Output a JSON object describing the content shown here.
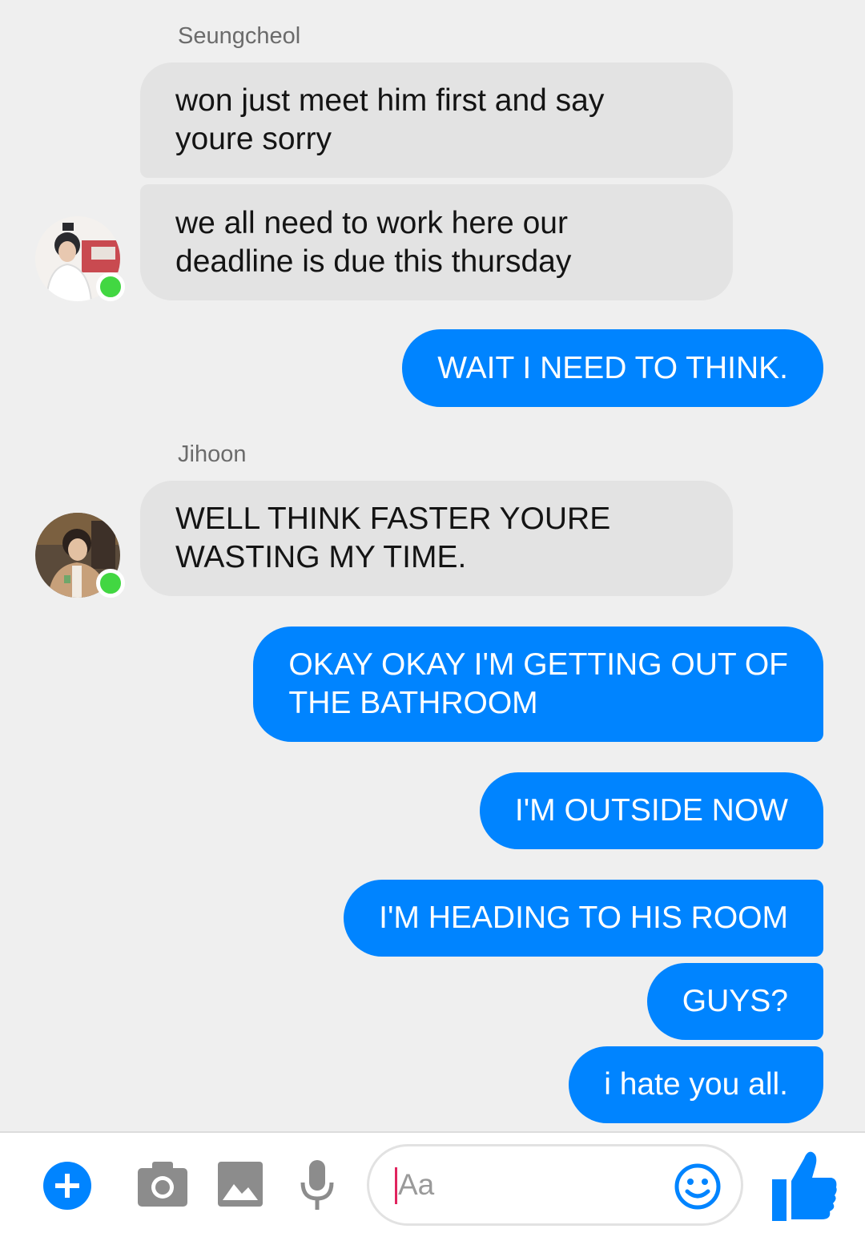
{
  "messages": [
    {
      "type": "sender",
      "name": "Seungcheol"
    },
    {
      "type": "in",
      "text": "won just meet him first and say\nyoure sorry"
    },
    {
      "type": "in",
      "text": "we all need to work here our\ndeadline is due this thursday"
    },
    {
      "type": "out",
      "text": "WAIT I NEED TO THINK."
    },
    {
      "type": "sender",
      "name": "Jihoon"
    },
    {
      "type": "in",
      "text": "WELL THINK FASTER YOURE\nWASTING MY TIME."
    },
    {
      "type": "out",
      "text": "OKAY OKAY I'M GETTING OUT OF\nTHE BATHROOM"
    },
    {
      "type": "out",
      "text": "I'M OUTSIDE NOW"
    },
    {
      "type": "out",
      "text": "I'M HEADING TO HIS ROOM"
    },
    {
      "type": "out",
      "text": "GUYS?"
    },
    {
      "type": "out",
      "text": "i hate you all."
    }
  ],
  "composer": {
    "placeholder": "Aa",
    "icons": [
      "plus-icon",
      "camera-icon",
      "image-icon",
      "microphone-icon",
      "emoji-icon",
      "thumbs-up-icon"
    ]
  },
  "colors": {
    "outgoing_bubble": "#0084ff",
    "incoming_bubble": "#e3e3e3",
    "background": "#efefef",
    "online_dot": "#42d742",
    "accent": "#0084ff"
  }
}
